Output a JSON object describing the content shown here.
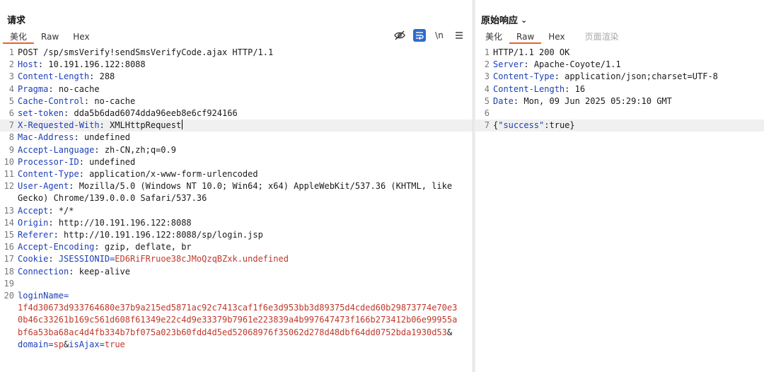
{
  "request": {
    "title": "请求",
    "tabs": [
      "美化",
      "Raw",
      "Hex"
    ],
    "active_tab": "美化",
    "request_line": "POST /sp/smsVerify!sendSmsVerifyCode.ajax HTTP/1.1",
    "headers": [
      {
        "line": 2,
        "key": "Host",
        "value": "10.191.196.122:8088"
      },
      {
        "line": 3,
        "key": "Content-Length",
        "value": "288"
      },
      {
        "line": 4,
        "key": "Pragma",
        "value": "no-cache"
      },
      {
        "line": 5,
        "key": "Cache-Control",
        "value": "no-cache"
      },
      {
        "line": 6,
        "key": "set-token",
        "value": "dda5b6dad6074dda96eeb8e6cf924166"
      },
      {
        "line": 7,
        "key": "X-Requested-With",
        "value": "XMLHttpRequest"
      },
      {
        "line": 8,
        "key": "Mac-Address",
        "value": "undefined"
      },
      {
        "line": 9,
        "key": "Accept-Language",
        "value": "zh-CN,zh;q=0.9"
      },
      {
        "line": 10,
        "key": "Processor-ID",
        "value": "undefined"
      },
      {
        "line": 11,
        "key": "Content-Type",
        "value": "application/x-www-form-urlencoded"
      },
      {
        "line": 12,
        "key": "User-Agent",
        "value": "Mozilla/5.0 (Windows NT 10.0; Win64; x64) AppleWebKit/537.36 (KHTML, like Gecko) Chrome/139.0.0.0 Safari/537.36"
      },
      {
        "line": 13,
        "key": "Accept",
        "value": "*/*"
      },
      {
        "line": 14,
        "key": "Origin",
        "value": "http://10.191.196.122:8088"
      },
      {
        "line": 15,
        "key": "Referer",
        "value": "http://10.191.196.122:8088/sp/login.jsp"
      },
      {
        "line": 16,
        "key": "Accept-Encoding",
        "value": "gzip, deflate, br"
      }
    ],
    "cookie": {
      "line": 17,
      "key": "Cookie",
      "name": "JSESSIONID",
      "value": "ED6RiFRruoe38cJMoQzqBZxk.undefined"
    },
    "connection": {
      "line": 18,
      "key": "Connection",
      "value": "keep-alive"
    },
    "body": {
      "line": 20,
      "loginName_key": "loginName",
      "loginName_value": "1f4d30673d933764680e37b9a215ed5871ac92c7413caf1f6e3d953bb3d89375d4cded60b29873774e70e30b46c33261b169c561d608f61349e22c4d9e33379b7961e223839a4b997647473f166b273412b06e99955abf6a53ba68ac4d4fb334b7bf075a023b60fdd4d5ed52068976f35062d278d48dbf64dd0752bda1930d53",
      "domain_key": "domain",
      "domain_value": "sp",
      "isAjax_key": "isAjax",
      "isAjax_value": "true"
    }
  },
  "response": {
    "title": "原始响应",
    "tabs": [
      "美化",
      "Raw",
      "Hex",
      "页面渲染"
    ],
    "active_tab": "Raw",
    "status_line": "HTTP/1.1 200 OK",
    "headers": [
      {
        "line": 2,
        "key": "Server",
        "value": "Apache-Coyote/1.1"
      },
      {
        "line": 3,
        "key": "Content-Type",
        "value": "application/json;charset=UTF-8"
      },
      {
        "line": 4,
        "key": "Content-Length",
        "value": "16"
      },
      {
        "line": 5,
        "key": "Date",
        "value": "Mon, 09 Jun 2025 05:29:10 GMT"
      }
    ],
    "body_line": 7,
    "body_key": "\"success\"",
    "body_value": "true"
  },
  "toolbar": {
    "newline_label": "\\n",
    "icons": [
      "hide-icon",
      "wrap-icon",
      "newline-icon",
      "menu-icon"
    ]
  },
  "colors": {
    "key": "#1c3fb7",
    "value_red": "#c0392b",
    "accent": "#e8632b",
    "toggle_on": "#2f6cc8"
  }
}
